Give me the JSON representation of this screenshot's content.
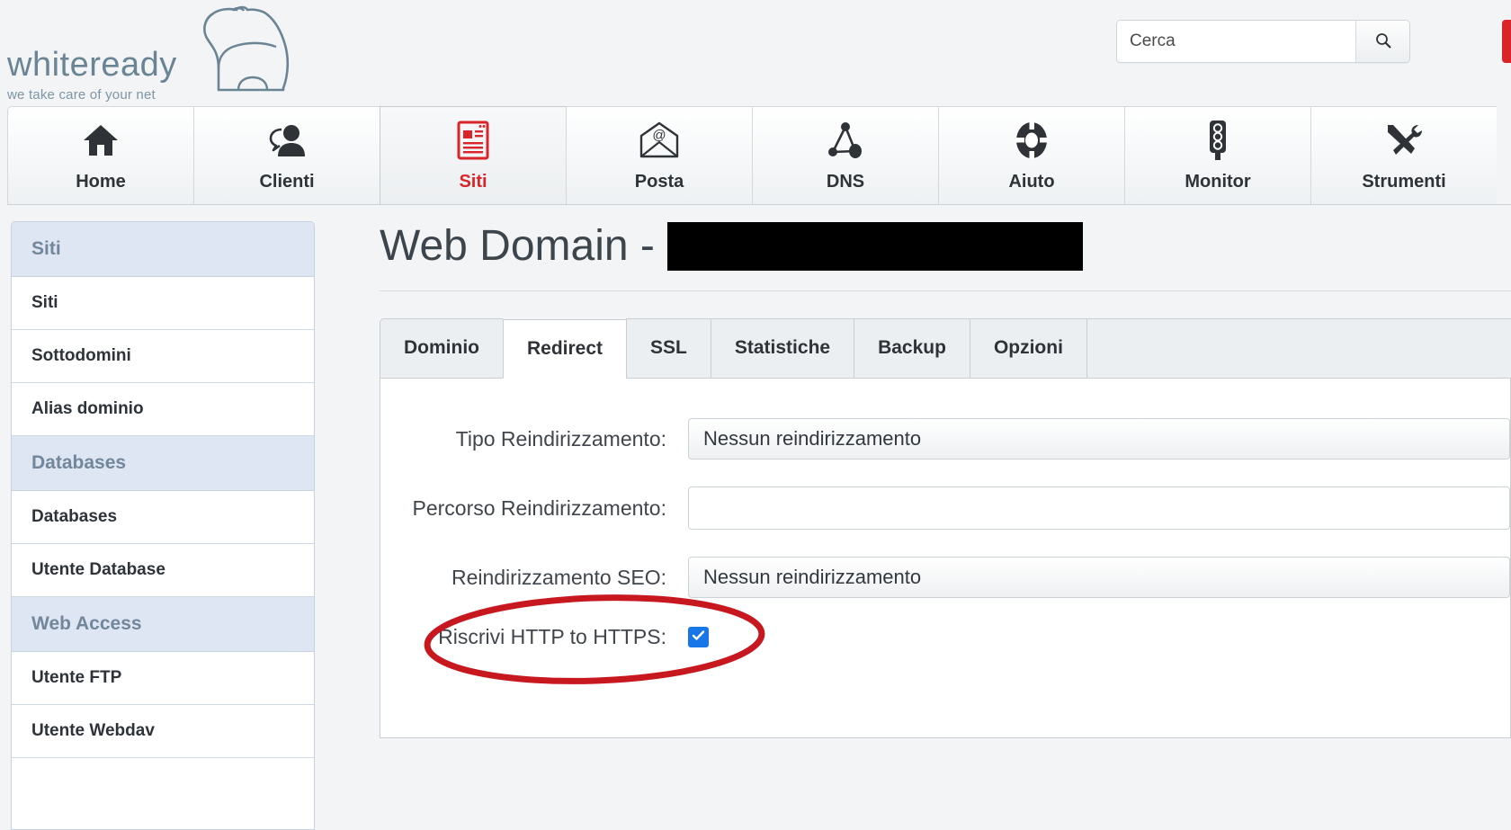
{
  "brand": {
    "name": "whiteready",
    "tagline": "we take care of your net",
    "logo_icon": "polar-bear-icon"
  },
  "search": {
    "placeholder": "Cerca",
    "value": "",
    "button_icon": "search-icon"
  },
  "colors": {
    "accent_red": "#d9252a",
    "checkbox_blue": "#1976e8",
    "section_header_bg": "#dde6f2",
    "annotation_red": "#c8181f"
  },
  "mainnav": {
    "items": [
      {
        "label": "Home",
        "icon": "home-icon",
        "active": false
      },
      {
        "label": "Clienti",
        "icon": "users-icon",
        "active": false
      },
      {
        "label": "Siti",
        "icon": "document-icon",
        "active": true
      },
      {
        "label": "Posta",
        "icon": "envelope-at-icon",
        "active": false
      },
      {
        "label": "DNS",
        "icon": "network-icon",
        "active": false
      },
      {
        "label": "Aiuto",
        "icon": "lifering-icon",
        "active": false
      },
      {
        "label": "Monitor",
        "icon": "traffic-light-icon",
        "active": false
      },
      {
        "label": "Strumenti",
        "icon": "tools-icon",
        "active": false
      }
    ]
  },
  "sidebar": {
    "groups": [
      {
        "header": "Siti",
        "items": [
          "Siti",
          "Sottodomini",
          "Alias dominio"
        ]
      },
      {
        "header": "Databases",
        "items": [
          "Databases",
          "Utente Database"
        ]
      },
      {
        "header": "Web Access",
        "items": [
          "Utente FTP",
          "Utente Webdav"
        ]
      }
    ]
  },
  "page": {
    "title_prefix": "Web Domain - ",
    "title_redacted": true
  },
  "tabs": [
    {
      "label": "Dominio",
      "active": false
    },
    {
      "label": "Redirect",
      "active": true
    },
    {
      "label": "SSL",
      "active": false
    },
    {
      "label": "Statistiche",
      "active": false
    },
    {
      "label": "Backup",
      "active": false
    },
    {
      "label": "Opzioni",
      "active": false
    }
  ],
  "form": {
    "redirect_type": {
      "label": "Tipo Reindirizzamento:",
      "value": "Nessun reindirizzamento"
    },
    "redirect_path": {
      "label": "Percorso Reindirizzamento:",
      "value": "",
      "placeholder": ""
    },
    "seo_redirect": {
      "label": "Reindirizzamento SEO:",
      "value": "Nessun reindirizzamento"
    },
    "rewrite_https": {
      "label": "Riscrivi HTTP to HTTPS:",
      "checked": true
    }
  }
}
